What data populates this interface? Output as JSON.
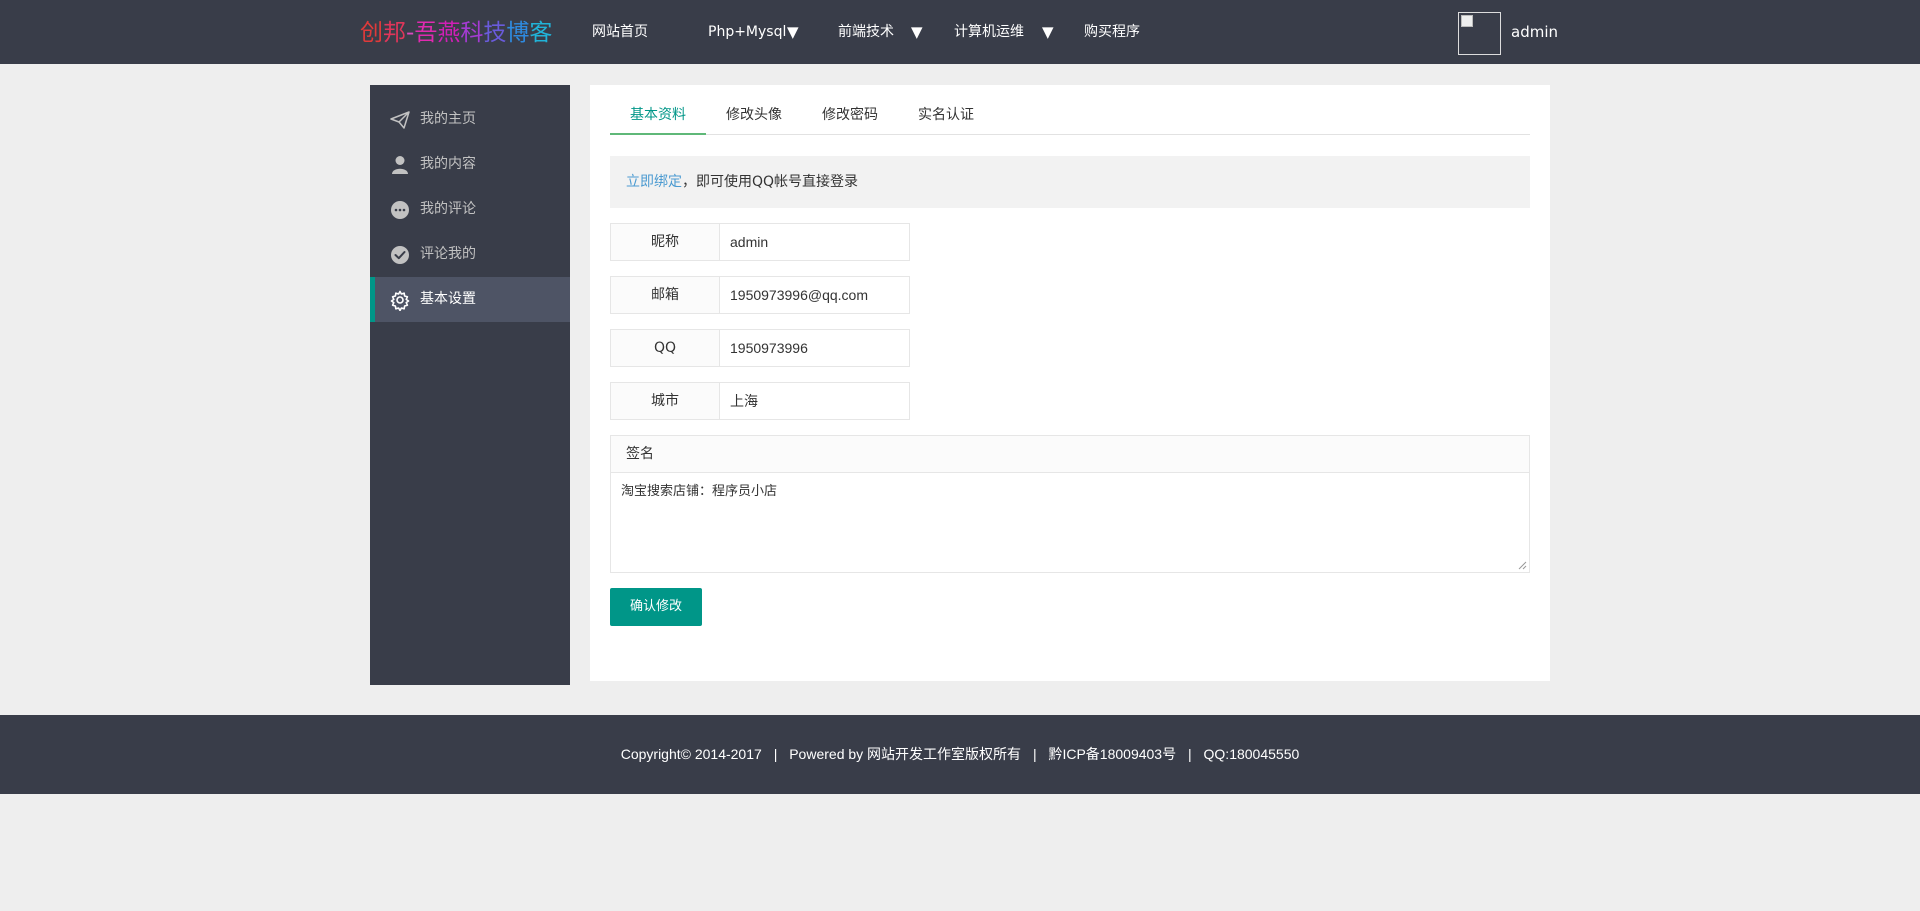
{
  "header": {
    "logo_chars": [
      "创",
      "邦",
      "-",
      "吾",
      "燕",
      "科",
      "技",
      "博",
      "客"
    ],
    "logo_colors": [
      "#e03a3a",
      "#e0365a",
      "#d94abf",
      "#e02ab0",
      "#d11fb6",
      "#a53bd2",
      "#6a5bdc",
      "#2e8ae0",
      "#21b3d8"
    ],
    "nav": [
      {
        "label": "网站首页",
        "dropdown": false
      },
      {
        "label": "Php+Mysql",
        "dropdown": true,
        "caret": "▼"
      },
      {
        "label": "前端技术",
        "dropdown": true,
        "caret": "▼"
      },
      {
        "label": "计算机运维",
        "dropdown": true,
        "caret": "▼"
      },
      {
        "label": "购买程序",
        "dropdown": false
      }
    ],
    "username": "admin"
  },
  "sidebar": {
    "items": [
      {
        "label": "我的主页",
        "icon": "paper-plane-icon",
        "active": false
      },
      {
        "label": "我的内容",
        "icon": "user-icon",
        "active": false
      },
      {
        "label": "我的评论",
        "icon": "chat-bubble-icon",
        "active": false
      },
      {
        "label": "评论我的",
        "icon": "check-circle-icon",
        "active": false
      },
      {
        "label": "基本设置",
        "icon": "gear-icon",
        "active": true
      }
    ]
  },
  "main": {
    "tabs": [
      {
        "label": "基本资料",
        "active": true
      },
      {
        "label": "修改头像",
        "active": false
      },
      {
        "label": "修改密码",
        "active": false
      },
      {
        "label": "实名认证",
        "active": false
      }
    ],
    "notice": {
      "link": "立即绑定",
      "text": "，即可使用QQ帐号直接登录"
    },
    "form": {
      "nickname": {
        "label": "昵称",
        "value": "admin"
      },
      "email": {
        "label": "邮箱",
        "value": "1950973996@qq.com"
      },
      "qq": {
        "label": "QQ",
        "value": "1950973996"
      },
      "city": {
        "label": "城市",
        "value": "上海"
      },
      "signature": {
        "label": "签名",
        "value": "淘宝搜索店铺：程序员小店"
      }
    },
    "submit_label": "确认修改"
  },
  "footer": {
    "copyright": "Copyright© 2014-2017",
    "powered": "Powered by 网站开发工作室版权所有",
    "icp": "黔ICP备18009403号",
    "qq": "QQ:180045550",
    "separator": "|"
  },
  "colors": {
    "header_bg": "#393d49",
    "accent": "#009688",
    "link": "#4c9bd1"
  }
}
